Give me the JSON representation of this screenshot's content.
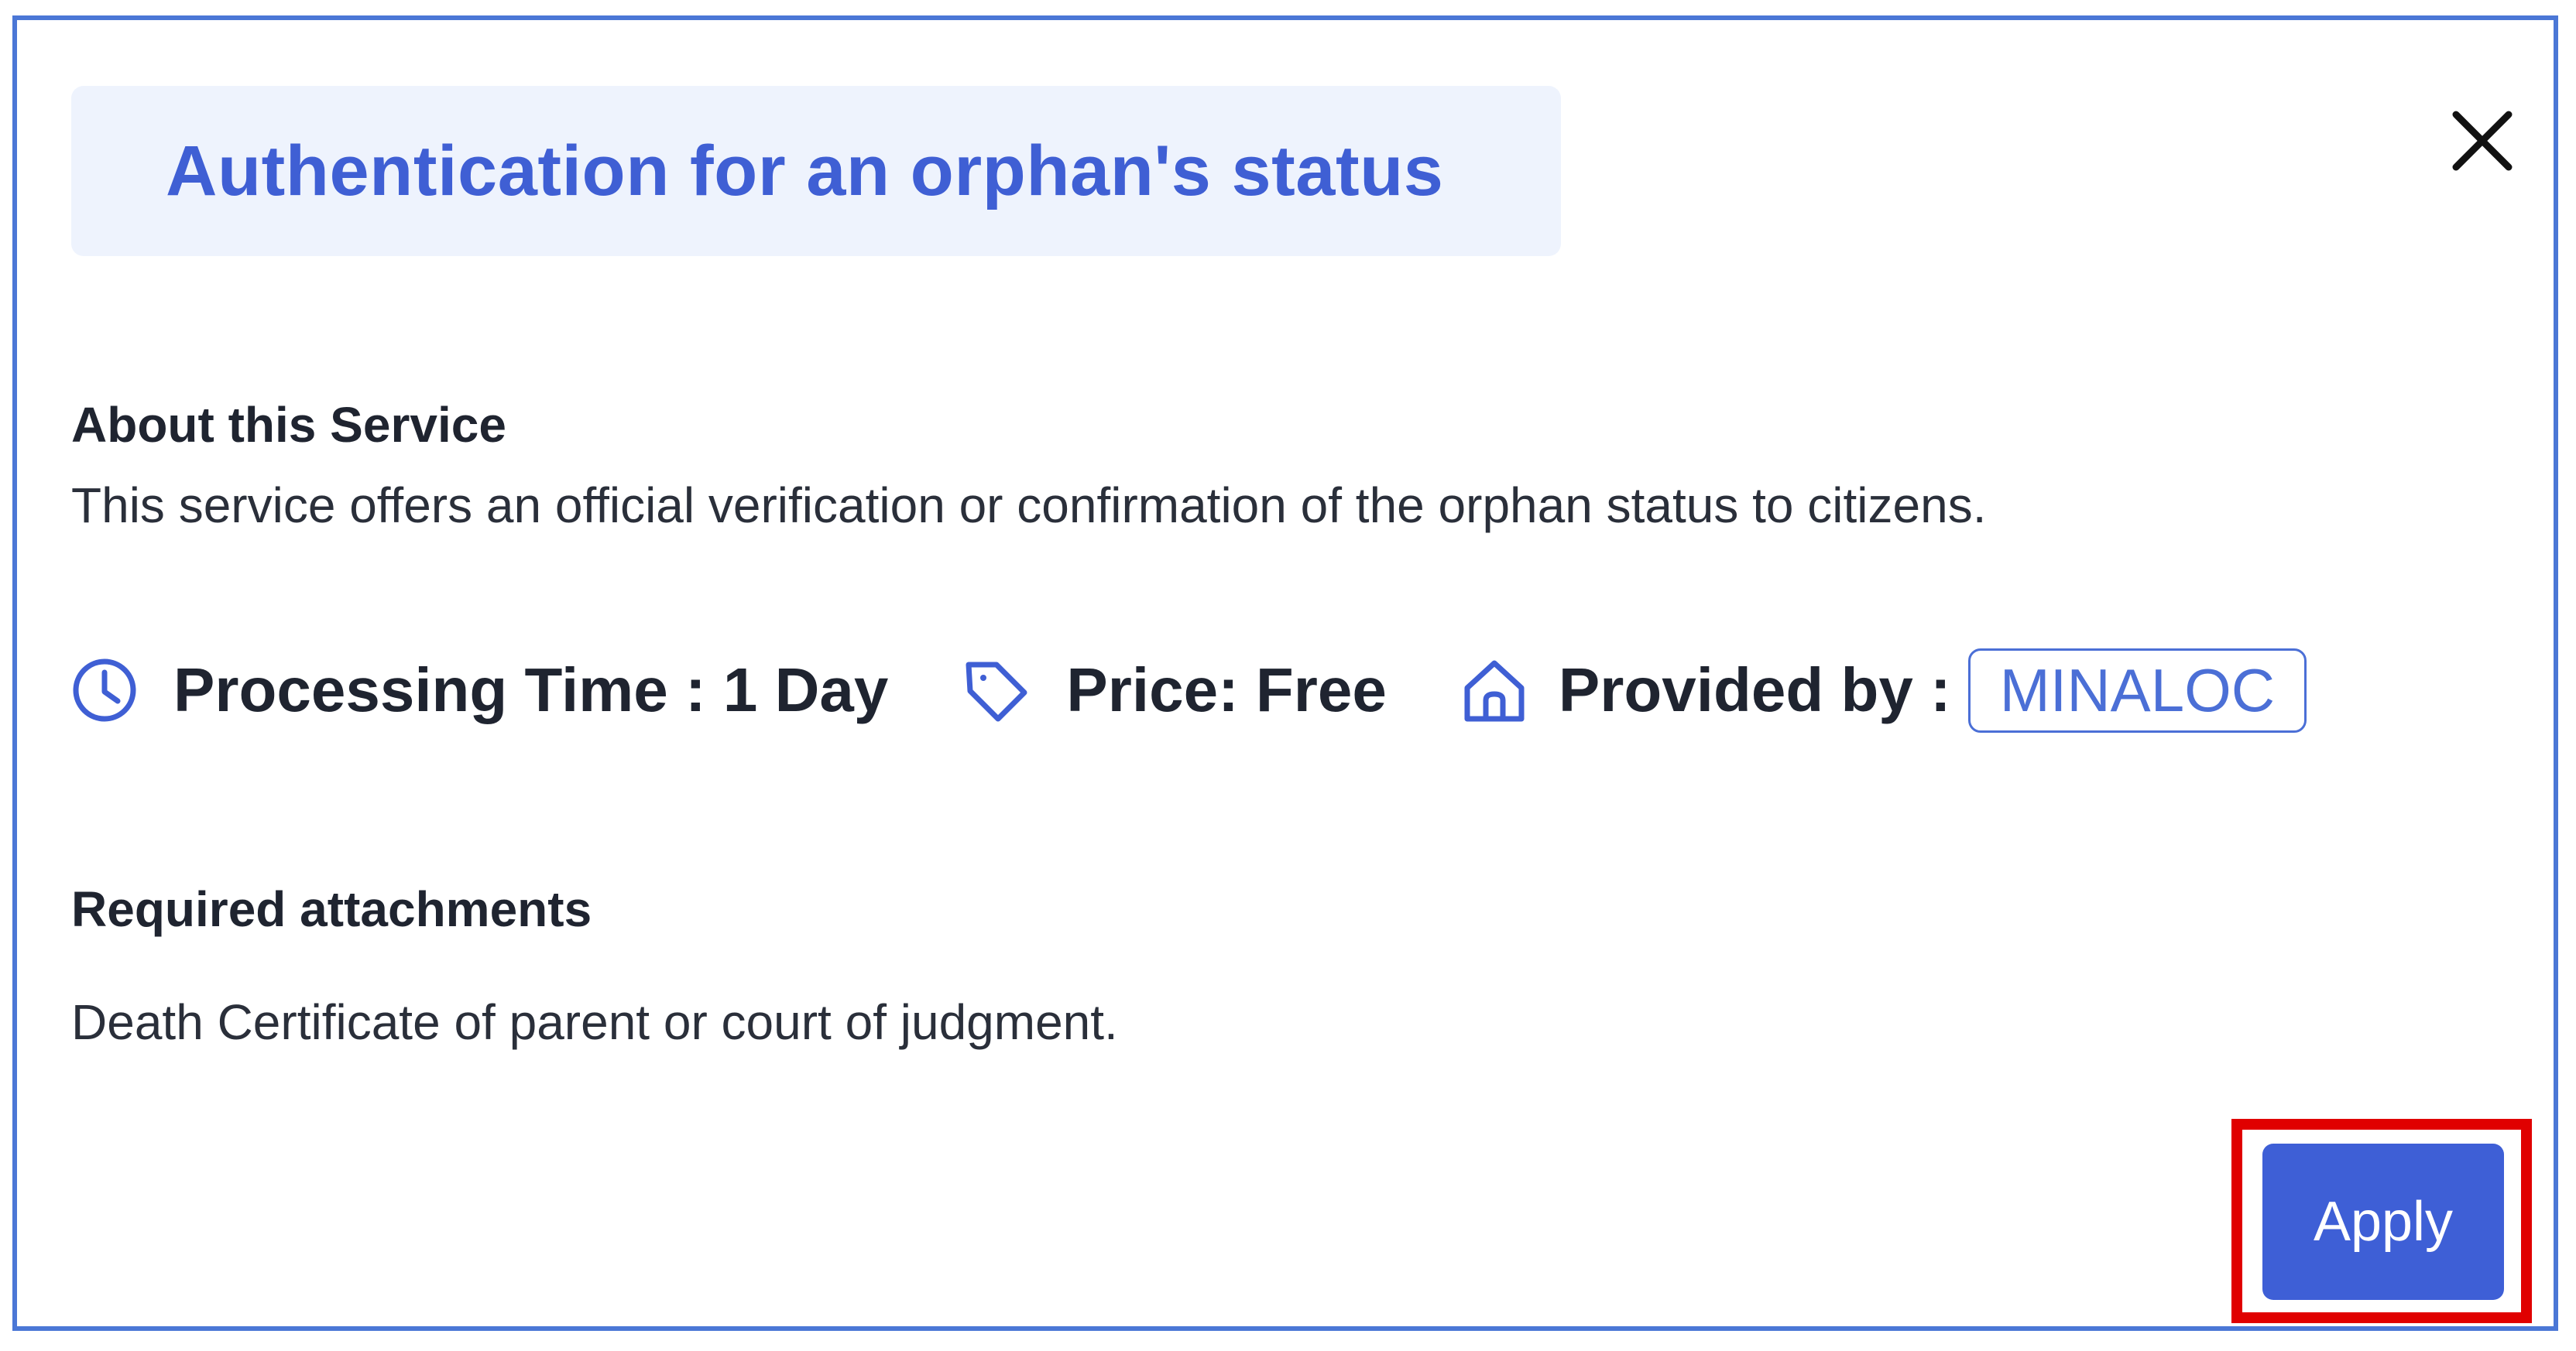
{
  "dialog": {
    "title": "Authentication for an orphan's status",
    "close_icon": "close-icon"
  },
  "about": {
    "heading": "About this Service",
    "description": "This service offers an official verification or confirmation of the orphan status to citizens."
  },
  "meta": {
    "processing_icon": "clock-icon",
    "processing_time": "Processing Time : 1 Day",
    "price_icon": "tag-icon",
    "price": "Price: Free",
    "provider_icon": "home-icon",
    "provided_by_label": "Provided by :",
    "provider": "MINALOC"
  },
  "attachments": {
    "heading": "Required attachments",
    "text": "Death Certificate of parent or court of judgment."
  },
  "actions": {
    "apply_label": "Apply"
  },
  "colors": {
    "accent": "#3e5fd6",
    "title_bg": "#eef3fd",
    "frame_border": "#4b77d6",
    "highlight": "#e00000"
  }
}
